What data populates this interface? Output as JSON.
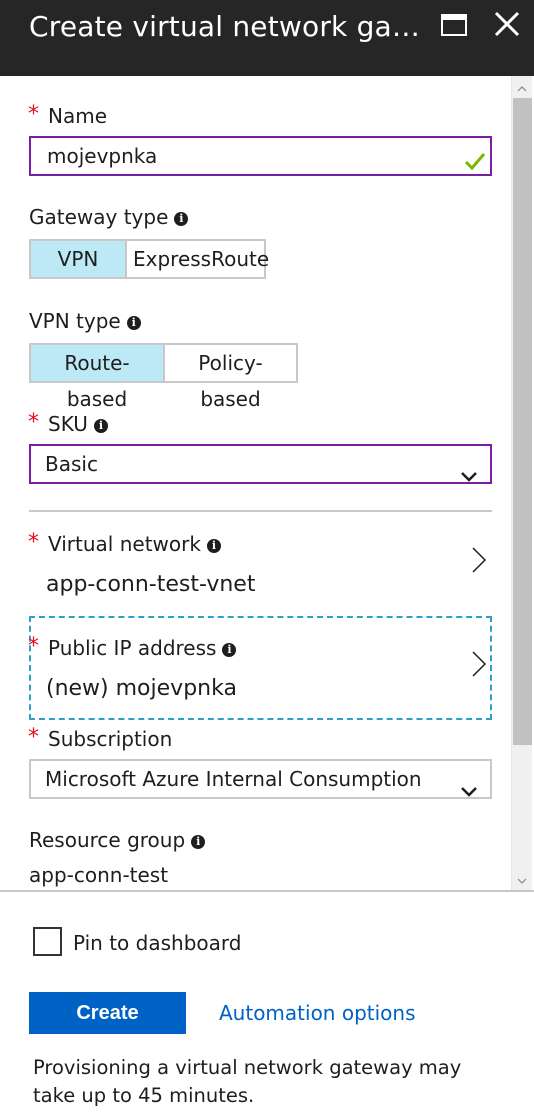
{
  "header": {
    "title": "Create virtual network gatew..."
  },
  "form": {
    "name": {
      "label": "Name",
      "required": "*",
      "value": "mojevpnka"
    },
    "gateway_type": {
      "label": "Gateway type",
      "options": [
        "VPN",
        "ExpressRoute"
      ],
      "selected": "VPN"
    },
    "vpn_type": {
      "label": "VPN type",
      "options": [
        "Route-based",
        "Policy-based"
      ],
      "selected": "Route-based"
    },
    "sku": {
      "label": "SKU",
      "required": "*",
      "value": "Basic"
    },
    "virtual_network": {
      "label": "Virtual network",
      "required": "*",
      "value": "app-conn-test-vnet"
    },
    "public_ip": {
      "label": "Public IP address",
      "required": "*",
      "value": "(new) mojevpnka"
    },
    "subscription": {
      "label": "Subscription",
      "required": "*",
      "value": "Microsoft Azure Internal Consumption"
    },
    "resource_group": {
      "label": "Resource group",
      "value": "app-conn-test"
    }
  },
  "footer": {
    "pin_label": "Pin to dashboard",
    "create_label": "Create",
    "automation_label": "Automation options",
    "note": "Provisioning a virtual network gateway may take up to 45 minutes."
  },
  "colors": {
    "header_bg": "#262626",
    "accent": "#0062c4",
    "invalid_border": "#7a1fa2",
    "selected_segment": "#bde8f5",
    "required": "#e81123",
    "valid_check": "#7ab800"
  },
  "icons": [
    "maximize-icon",
    "close-icon",
    "info-icon",
    "check-icon",
    "chevron-down-icon",
    "chevron-right-icon"
  ]
}
